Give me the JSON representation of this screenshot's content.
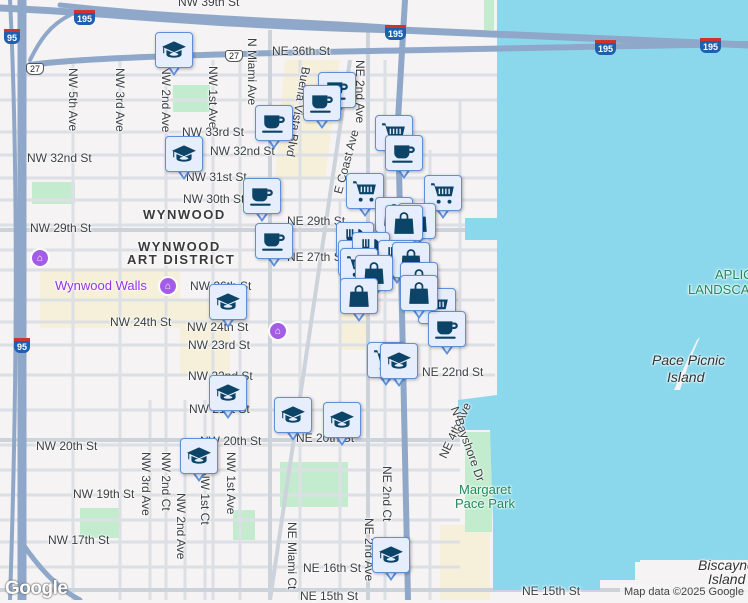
{
  "map": {
    "colors": {
      "water": "#8bd8ec",
      "land": "#f5f3f4",
      "highway": "#8fa8c9",
      "park": "#c3eccf",
      "commercial": "#f6efd9",
      "marker_border": "#5c8fdc",
      "marker_icon": "#0c4468"
    },
    "street_labels": [
      "NW 39th St",
      "NE 36th St",
      "N Miami Ave",
      "NW 5th Ave",
      "NW 3rd Ave",
      "NW 2nd Ave",
      "NW 1st Ave",
      "Buena Vista Blvd",
      "NE 2nd Ave",
      "E Coast Ave",
      "NW 33rd St",
      "NW 32nd St",
      "NW 32nd St",
      "NW 31st St",
      "NW 30th St",
      "NW 29th St",
      "NE 29th St",
      "NE 27th St",
      "NW 26th St",
      "NW 24th St",
      "NW 24th St",
      "NW 23rd St",
      "NW 22nd St",
      "NW 21st St",
      "NW 20th St",
      "NW 20th St",
      "NE 20th St",
      "NE 22nd St",
      "NW 19th St",
      "NW 17th St",
      "NW 3rd Ave",
      "NW 2nd Ct",
      "NW 2nd Ave",
      "NW 1st Ct",
      "NW 1st Ave",
      "NE Miami Ct",
      "NE 2nd Ave",
      "NE 2nd Ct",
      "NE 4th Ave",
      "N Bayshore Dr",
      "NE 16th St",
      "NE 15th St",
      "NE 15th St"
    ],
    "area_labels": [
      "WYNWOOD",
      "WYNWOOD",
      "ART DISTRICT"
    ],
    "poi_labels": {
      "wynwood_walls": "Wynwood Walls",
      "margaret_pace_park_1": "Margaret",
      "margaret_pace_park_2": "Pace Park",
      "pace_picnic_1": "Pace Picnic",
      "pace_picnic_2": "Island",
      "aplic_1": "APLIC",
      "aplic_2": "LANDSCA",
      "biscayne_1": "Biscayne",
      "biscayne_2": "Island"
    },
    "highway_shields": {
      "i195_a": "195",
      "i195_b": "195",
      "i195_c": "195",
      "i95_a": "95",
      "i95_b": "95",
      "us27_a": "27",
      "us27_b": "27"
    },
    "markers": [
      "school",
      "school",
      "cafe",
      "cafe",
      "cafe",
      "cafe",
      "cafe",
      "grocery",
      "cafe",
      "grocery",
      "grocery",
      "shopping",
      "shopping",
      "shopping",
      "restaurant",
      "grocery",
      "restaurant",
      "restaurant",
      "shopping",
      "grocery",
      "shopping",
      "shopping",
      "grocery",
      "cafe",
      "school",
      "grocery",
      "school",
      "school",
      "school",
      "school",
      "school",
      "school"
    ],
    "google_logo": "Google",
    "attribution": "Map data ©2025 Google"
  }
}
